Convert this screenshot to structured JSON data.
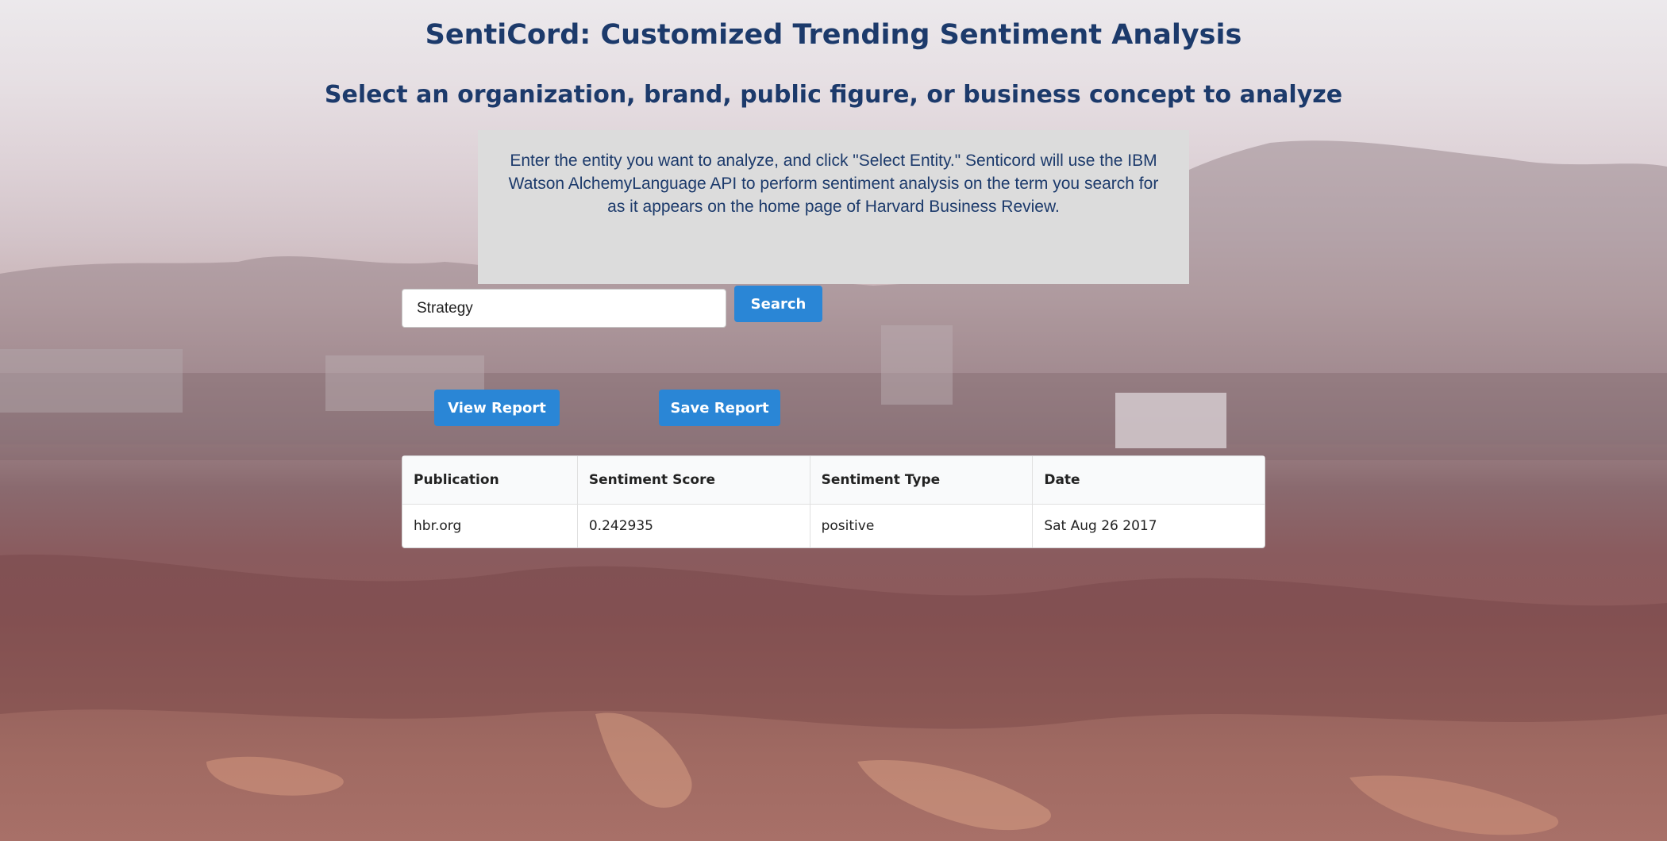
{
  "header": {
    "title": "SentiCord: Customized Trending Sentiment Analysis",
    "subtitle": "Select an organization, brand, public figure, or business concept to analyze"
  },
  "info": {
    "text": "Enter the entity you want to analyze, and click \"Select Entity.\" Senticord will use the IBM Watson AlchemyLanguage API to perform sentiment analysis on the term you search for as it appears on the home page of Harvard Business Review."
  },
  "search": {
    "value": "Strategy",
    "button_label": "Search"
  },
  "actions": {
    "view_report_label": "View Report",
    "save_report_label": "Save Report"
  },
  "table": {
    "headers": [
      "Publication",
      "Sentiment Score",
      "Sentiment Type",
      "Date"
    ],
    "rows": [
      [
        "hbr.org",
        "0.242935",
        "positive",
        "Sat Aug 26 2017"
      ]
    ]
  },
  "colors": {
    "heading": "#1c3a6b",
    "button": "#2a86d6",
    "info_box": "#dcdcdc"
  }
}
